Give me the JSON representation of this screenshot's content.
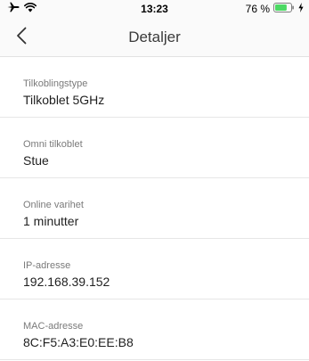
{
  "status_bar": {
    "time": "13:23",
    "battery_text": "76 %",
    "battery_level": 0.76,
    "icons": [
      "airplane-icon",
      "wifi-icon",
      "battery-icon",
      "charging-bolt-icon"
    ]
  },
  "nav": {
    "title": "Detaljer",
    "back_icon": "chevron-left-icon"
  },
  "details": [
    {
      "label": "Tilkoblingstype",
      "value": "Tilkoblet 5GHz"
    },
    {
      "label": "Omni tilkoblet",
      "value": "Stue"
    },
    {
      "label": "Online varihet",
      "value": "1 minutter"
    },
    {
      "label": "IP-adresse",
      "value": "192.168.39.152"
    },
    {
      "label": "MAC-adresse",
      "value": "8C:F5:A3:E0:EE:B8"
    }
  ],
  "colors": {
    "battery_fill": "#4cd964",
    "separator": "#e6e6e6",
    "label": "#7a7a7a",
    "value": "#1f1f1f"
  }
}
